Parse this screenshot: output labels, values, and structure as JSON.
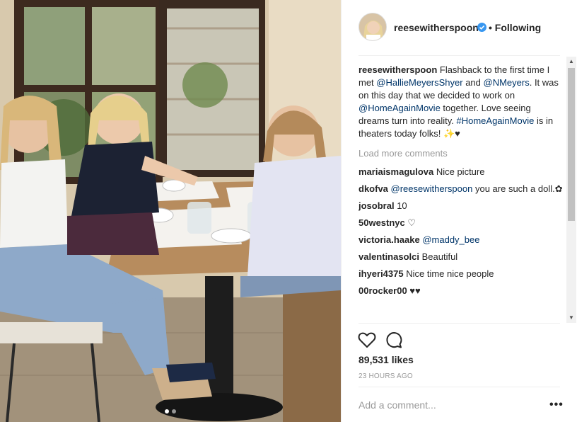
{
  "post": {
    "username": "reesewitherspoon",
    "separator": "•",
    "follow_state": "Following",
    "caption": {
      "username": "reesewitherspoon",
      "t1": " Flashback to the first time I met ",
      "m1": "@HallieMeyersShyer",
      "t2": " and ",
      "m2": "@NMeyers",
      "t3": ". It was on this day that we decided to work on ",
      "m3": "@HomeAgainMovie",
      "t4": " together. Love seeing dreams turn into reality. ",
      "m4": "#HomeAgainMovie",
      "t5": " is in theaters today folks! ✨♥"
    },
    "load_more": "Load more comments",
    "comments": [
      {
        "user": "mariaismagulova",
        "text": " Nice picture"
      },
      {
        "user": "dkofva",
        "mention": "@reesewitherspoon",
        "text": " you are such a doll.✿"
      },
      {
        "user": "josobral",
        "text": " 10"
      },
      {
        "user": "50westnyc",
        "text": " ♡"
      },
      {
        "user": "victoria.haake",
        "mention": "@maddy_bee",
        "text": ""
      },
      {
        "user": "valentinasolci",
        "text": " Beautiful"
      },
      {
        "user": "ihyeri4375",
        "text": " Nice time nice people"
      },
      {
        "user": "00rocker00",
        "text": " ♥♥"
      }
    ],
    "likes": "89,531 likes",
    "timestamp": "23 HOURS AGO",
    "add_comment_placeholder": "Add a comment...",
    "more_glyph": "•••"
  },
  "scrollbar": {
    "up_glyph": "▲",
    "down_glyph": "▼"
  },
  "photo": {
    "carousel_count": 2,
    "carousel_active": 1,
    "description_icon": "photo-of-three-women-at-cafe-table"
  },
  "colors": {
    "link": "#003569",
    "muted": "#999999",
    "verified": "#3897f0",
    "text": "#262626"
  }
}
